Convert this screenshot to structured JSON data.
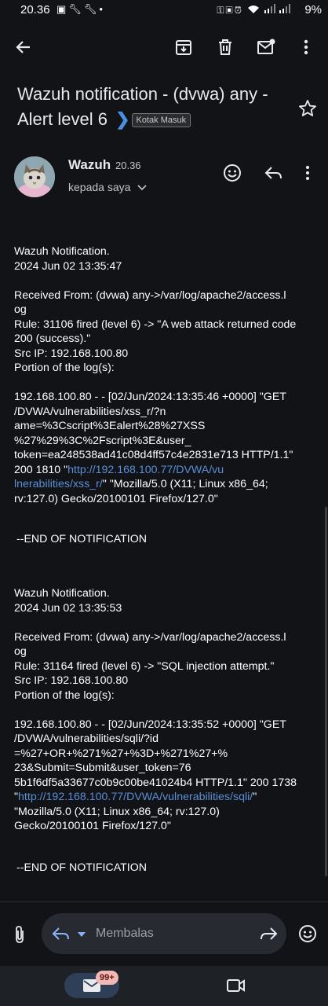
{
  "status_bar": {
    "time": "20.36",
    "left_icons": [
      "gallery-icon",
      "wrench-icon",
      "wrench-icon",
      "dot-icon"
    ],
    "right_icons": [
      "key-icon",
      "image-icon",
      "alarm-icon",
      "wifi-icon",
      "signal-icon",
      "signal-icon"
    ],
    "battery": "9%"
  },
  "toolbar": {
    "icons": [
      "back-arrow-icon",
      "archive-icon",
      "delete-icon",
      "mark-unread-icon",
      "more-vert-icon"
    ]
  },
  "email": {
    "subject": "Wazuh notification - (dvwa) any - Alert level 6",
    "label": "Kotak Masuk",
    "sender": "Wazuh",
    "time": "20.36",
    "recipient": "kepada saya",
    "messages": [
      {
        "title": "Wazuh Notification.",
        "date": "2024 Jun 02 13:35:47",
        "received_from": "Received From: (dvwa) any->/var/log/apache2/access.l\nog",
        "rule": "Rule: 31106 fired (level 6) -> \"A web attack returned code 200 (success).\"",
        "src_ip": "Src IP: 192.168.100.80",
        "portion_label": "Portion of the log(s):",
        "log_before_link": "192.168.100.80 - - [02/Jun/2024:13:35:46 +0000] \"GET\n/DVWA/vulnerabilities/xss_r/?n\name=%3Cscript%3Ealert%28%27XSS\n%27%29%3C%2Fscript%3E&user_\ntoken=ea248538ad41c08d4ff57c4e2831e713 HTTP/1.1\"\n200 1810 \"",
        "link": "http://192.168.100.77/DVWA/vu\nlnerabilities/xss_r/",
        "log_after_link": "\" \"Mozilla/5.0 (X11; Linux x86_64;\nrv:127.0) Gecko/20100101 Firefox/127.0\"",
        "end": "--END OF NOTIFICATION"
      },
      {
        "title": "Wazuh Notification.",
        "date": "2024 Jun 02 13:35:53",
        "received_from": "Received From: (dvwa) any->/var/log/apache2/access.l\nog",
        "rule": "Rule: 31164 fired (level 6) -> \"SQL injection attempt.\"",
        "src_ip": "Src IP: 192.168.100.80",
        "portion_label": "Portion of the log(s):",
        "log_before_link": "192.168.100.80 - - [02/Jun/2024:13:35:52 +0000] \"GET\n/DVWA/vulnerabilities/sqli/?id\n=%27+OR+%271%27+%3D+%271%27+%\n23&Submit=Submit&user_token=76\n5b1f6df5a33677c0b9c00be41024b4 HTTP/1.1\" 200 1738\n\"",
        "link": "http://192.168.100.77/DVWA/vulnerabilities/sqli/",
        "log_after_link": "\"\n\"Mozilla/5.0 (X11; Linux x86_64; rv:127.0)\nGecko/20100101 Firefox/127.0\"",
        "end": "--END OF NOTIFICATION"
      }
    ]
  },
  "reply": {
    "placeholder": "Membalas"
  },
  "bottom_nav": {
    "mail_badge": "99+"
  },
  "colors": {
    "background": "#111316",
    "link": "#5b8fd6",
    "label_chevron": "#4a90e2",
    "badge": "#f2b8b5"
  }
}
